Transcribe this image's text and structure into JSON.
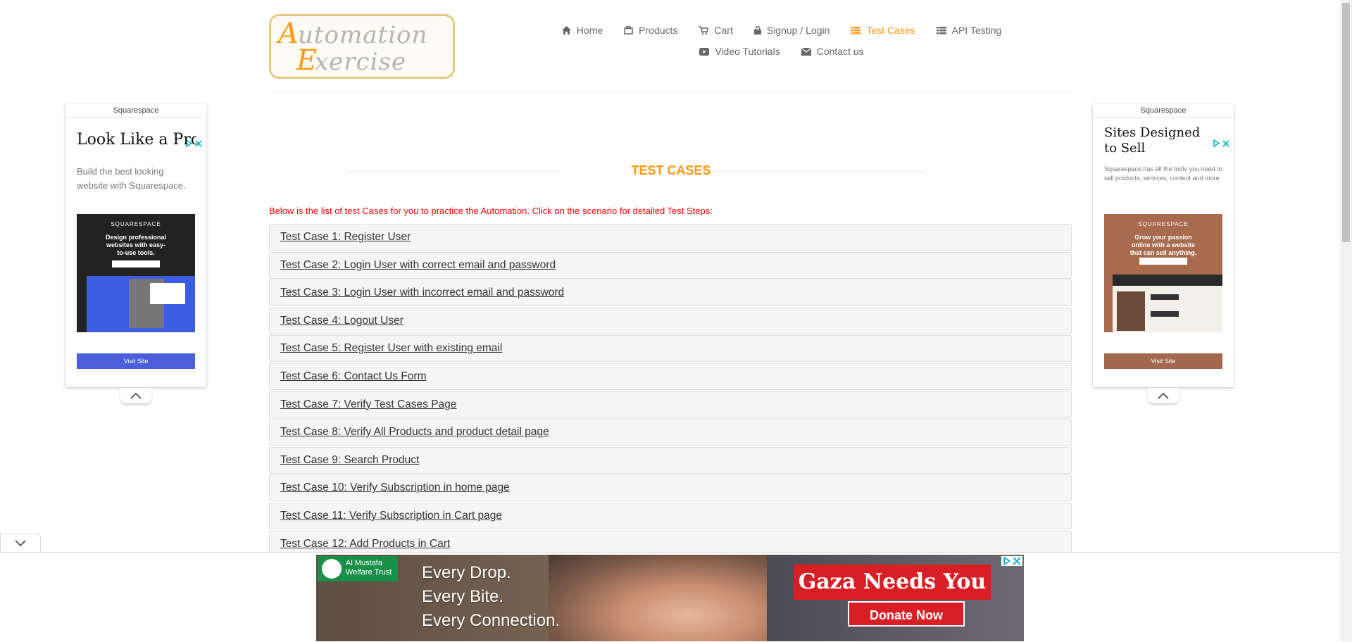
{
  "header": {
    "logo_text": "Automation Exercise",
    "nav": [
      {
        "label": "Home",
        "icon": "home-icon"
      },
      {
        "label": "Products",
        "icon": "products-icon"
      },
      {
        "label": "Cart",
        "icon": "cart-icon"
      },
      {
        "label": "Signup / Login",
        "icon": "lock-icon"
      },
      {
        "label": "Test Cases",
        "icon": "list-icon",
        "active": true
      },
      {
        "label": "API Testing",
        "icon": "list-icon"
      },
      {
        "label": "Video Tutorials",
        "icon": "youtube-icon"
      },
      {
        "label": "Contact us",
        "icon": "envelope-icon"
      }
    ]
  },
  "main": {
    "title": "TEST CASES",
    "intro": "Below is the list of test Cases for you to practice the Automation. Click on the scenario for detailed Test Steps:",
    "test_cases": [
      "Test Case 1: Register User",
      "Test Case 2: Login User with correct email and password",
      "Test Case 3: Login User with incorrect email and password",
      "Test Case 4: Logout User",
      "Test Case 5: Register User with existing email",
      "Test Case 6: Contact Us Form",
      "Test Case 7: Verify Test Cases Page",
      "Test Case 8: Verify All Products and product detail page",
      "Test Case 9: Search Product",
      "Test Case 10: Verify Subscription in home page",
      "Test Case 11: Verify Subscription in Cart page",
      "Test Case 12: Add Products in Cart"
    ]
  },
  "ads": {
    "left": {
      "advertiser": "Squarespace",
      "headline": "Look Like a Pro",
      "body": "Build the best looking website with Squarespace.",
      "image_brand": "SQUARESPACE",
      "image_text": "Design professional websites with easy-to-use tools.",
      "cta": "Visit Site",
      "cta_color": "#4a5fd8"
    },
    "right": {
      "advertiser": "Squarespace",
      "headline": "Sites Designed to Sell",
      "body": "Squarespace has all the tools you need to sell products, services, content and more.",
      "image_brand": "SQUARESPACE",
      "image_text": "Grow your passion online with a website that can sell anything.",
      "cta": "Visit Site",
      "cta_color": "#a2694f"
    },
    "bottom": {
      "org": "Al Mustafa Welfare Trust",
      "lines": [
        "Every Drop.",
        "Every Bite.",
        "Every Connection."
      ],
      "headline": "Gaza Needs You",
      "cta": "Donate Now"
    }
  },
  "colors": {
    "accent": "#fe980f",
    "intro_red": "#fe0000"
  }
}
